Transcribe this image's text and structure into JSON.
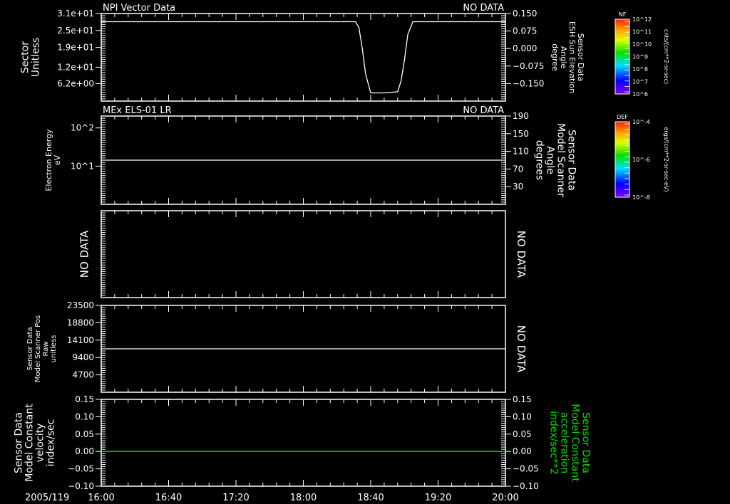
{
  "colors": {
    "background": "#000000",
    "axes": "#ffffff",
    "trace": "#ffffff",
    "accent_trace": "#00e000"
  },
  "chart_data": [
    {
      "type": "line",
      "title": "NPI Vector Data",
      "status": "NO DATA",
      "ylabel_left": [
        "Sector",
        "Unitless"
      ],
      "yticks_left": [
        "3.1e+01",
        "2.5e+01",
        "1.9e+01",
        "1.2e+01",
        "6.2e+00"
      ],
      "ylim_left": [
        0,
        31
      ],
      "ylabel_right": [
        "Sensor Data",
        "ESH Sun Elevation",
        "Angle",
        "degree"
      ],
      "yticks_right": [
        "0.150",
        "0.075",
        "0.000",
        "−0.075",
        "−0.150"
      ],
      "ylim_right": [
        -0.225,
        0.15
      ],
      "series": [
        {
          "axis": "right",
          "x": [
            "16:00",
            "18:31",
            "18:33",
            "18:35",
            "18:37",
            "18:40",
            "18:48",
            "18:56",
            "18:58",
            "19:00",
            "19:02",
            "19:05",
            "20:00"
          ],
          "y": [
            0.115,
            0.115,
            0.09,
            0.0,
            -0.11,
            -0.19,
            -0.19,
            -0.185,
            -0.14,
            -0.05,
            0.06,
            0.115,
            0.115
          ],
          "color": "#ffffff"
        }
      ]
    },
    {
      "type": "line",
      "title": "MEx ELS-01 LR",
      "status": "NO DATA",
      "ylabel_left": [
        "Electron Energy",
        "eV"
      ],
      "yticks_left": [
        "10^2",
        "10^1"
      ],
      "yscale_left": "log",
      "ylim_left": [
        1,
        205
      ],
      "ylabel_right": [
        "Sensor Data",
        "Model Scanner",
        "Angle",
        "degrees"
      ],
      "yticks_right": [
        "190",
        "150",
        "110",
        "70",
        "30"
      ],
      "ylim_right": [
        -10,
        190
      ],
      "series": [
        {
          "axis": "right",
          "x": [
            "16:00",
            "20:00"
          ],
          "y": [
            90,
            90
          ],
          "color": "#ffffff"
        }
      ]
    },
    {
      "type": "line",
      "left_text": "NO DATA",
      "right_text": "NO DATA",
      "series": []
    },
    {
      "type": "line",
      "ylabel_left": [
        "Sensor Data",
        "Model Scanner Pos",
        "Raw",
        "unitless"
      ],
      "yticks_left": [
        "23500",
        "18800",
        "14100",
        "9400",
        "4700"
      ],
      "ylim_left": [
        0,
        23500
      ],
      "right_text": "NO DATA",
      "series": [
        {
          "axis": "left",
          "x": [
            "16:00",
            "20:00"
          ],
          "y": [
            11750,
            11750
          ],
          "color": "#ffffff"
        }
      ]
    },
    {
      "type": "line",
      "ylabel_left": [
        "Sensor Data",
        "Model Constant",
        "velocity",
        "index/sec"
      ],
      "yticks_left": [
        "0.15",
        "0.10",
        "0.05",
        "0.00",
        "−0.05",
        "−0.10"
      ],
      "ylim_left": [
        -0.1,
        0.15
      ],
      "ylabel_right": [
        "Sensor Data",
        "Model Constant",
        "acceleration",
        "index/sec**2"
      ],
      "ylabel_right_color": "#00e000",
      "yticks_right": [
        "0.15",
        "0.10",
        "0.05",
        "0.00",
        "−0.05",
        "−0.10"
      ],
      "ylim_right": [
        -0.1,
        0.15
      ],
      "series": [
        {
          "axis": "left",
          "x": [
            "16:00",
            "20:00"
          ],
          "y": [
            0,
            0
          ],
          "color": "#00e000"
        }
      ]
    }
  ],
  "time_axis": {
    "date_label": "2005/119",
    "ticks": [
      "16:00",
      "16:40",
      "17:20",
      "18:00",
      "18:40",
      "19:20",
      "20:00"
    ],
    "range": [
      "16:00",
      "20:00"
    ]
  },
  "colorbars": [
    {
      "title": "NF",
      "ticks": [
        "10^12",
        "10^11",
        "10^10",
        "10^9",
        "10^8",
        "10^7",
        "10^6"
      ],
      "units": "cnts/(cm**2-sr-sec)"
    },
    {
      "title": "DEF",
      "ticks": [
        "10^-4",
        "10^-6",
        "10^-8"
      ],
      "units": "ergs/(cm**2-sr-sec-eV)"
    }
  ]
}
